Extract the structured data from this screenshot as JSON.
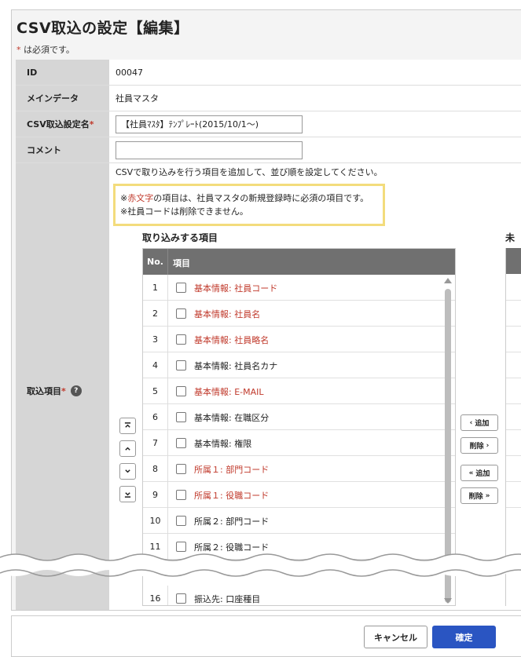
{
  "page": {
    "title": "CSV取込の設定【編集】",
    "required_star": "*",
    "required_note": " は必須です。"
  },
  "fields": {
    "id_label": "ID",
    "id_value": "00047",
    "main_data_label": "メインデータ",
    "main_data_value": "社員マスタ",
    "setting_name_label": "CSV取込設定名",
    "setting_name_value": "【社員ﾏｽﾀ】ﾃﾝﾌﾟﾚｰﾄ(2015/10/1～)",
    "comment_label": "コメント",
    "comment_value": "",
    "import_items_label": "取込項目",
    "help_icon": "?"
  },
  "import": {
    "hint": "CSVで取り込みを行う項目を追加して、並び順を設定してください。",
    "note_prefix": "※",
    "note_red": "赤文字",
    "note_rest": "の項目は、社員マスタの新規登録時に必須の項目です。",
    "note_line2": "※社員コードは削除できません。",
    "selected_title": "取り込みする項目",
    "unselected_title": "未",
    "col_no": "No.",
    "col_item": "項目",
    "rows": [
      {
        "no": "1",
        "label": "基本情報: 社員コード",
        "required": true
      },
      {
        "no": "2",
        "label": "基本情報: 社員名",
        "required": true
      },
      {
        "no": "3",
        "label": "基本情報: 社員略名",
        "required": true
      },
      {
        "no": "4",
        "label": "基本情報: 社員名カナ",
        "required": false
      },
      {
        "no": "5",
        "label": "基本情報: E-MAIL",
        "required": true
      },
      {
        "no": "6",
        "label": "基本情報: 在職区分",
        "required": false
      },
      {
        "no": "7",
        "label": "基本情報: 権限",
        "required": false
      },
      {
        "no": "8",
        "label": "所属１: 部門コード",
        "required": true
      },
      {
        "no": "9",
        "label": "所属１: 役職コード",
        "required": true
      },
      {
        "no": "10",
        "label": "所属２: 部門コード",
        "required": false
      },
      {
        "no": "11",
        "label": "所属２: 役職コード",
        "required": false
      },
      {
        "no": "16",
        "label": "振込先: 口座種目",
        "required": false
      }
    ],
    "add_label": "追加",
    "remove_label": "削除",
    "add_all_label": "追加",
    "remove_all_label": "削除"
  },
  "footer": {
    "cancel": "キャンセル",
    "ok": "確定"
  },
  "colors": {
    "required_text": "#c0392b",
    "primary_button": "#2a55c2",
    "note_border": "#f3dc7c"
  }
}
